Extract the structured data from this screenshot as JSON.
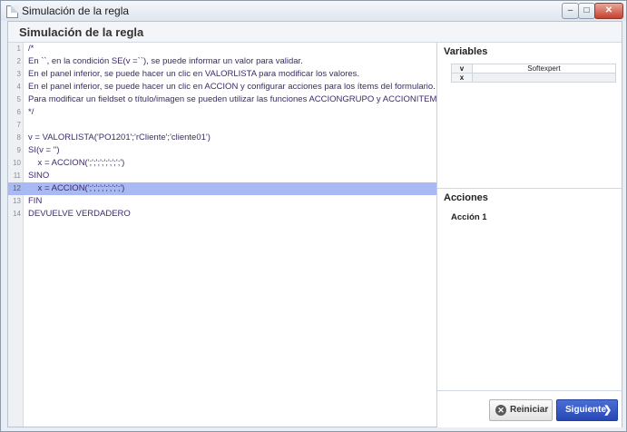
{
  "window": {
    "title": "Simulación de la regla",
    "controls": {
      "minimize": "–",
      "maximize": "□",
      "close": "✕"
    }
  },
  "dialog": {
    "title": "Simulación de la regla"
  },
  "editor": {
    "lines": [
      {
        "num": "1",
        "text": "/*"
      },
      {
        "num": "2",
        "text": "En ``, en la condición SE(v =``), se puede informar un valor para validar."
      },
      {
        "num": "3",
        "text": "En el panel inferior, se puede hacer un clic en VALORLISTA para modificar los valores."
      },
      {
        "num": "4",
        "text": "En el panel inferior, se puede hacer un clic en ACCION y configurar acciones para los ítems del formulario."
      },
      {
        "num": "5",
        "text": "Para modificar un fieldset o título/imagen se pueden utilizar las funciones ACCIONGRUPO y ACCIONITEMGRAFICO."
      },
      {
        "num": "6",
        "text": "*/"
      },
      {
        "num": "7",
        "text": ""
      },
      {
        "num": "8",
        "text": "v = VALORLISTA('PO1201';'rCliente';'cliente01')"
      },
      {
        "num": "9",
        "text": "SI(v = '')"
      },
      {
        "num": "10",
        "text": "    x = ACCION(';';';';';';';';')"
      },
      {
        "num": "11",
        "text": "SINO"
      },
      {
        "num": "12",
        "text": "    x = ACCION(';';';';';';';';')"
      },
      {
        "num": "13",
        "text": "FIN"
      },
      {
        "num": "14",
        "text": "DEVUELVE VERDADERO"
      }
    ],
    "highlighted_line": "12"
  },
  "variables": {
    "title": "Variables",
    "rows": [
      {
        "name": "v",
        "value": "Softexpert"
      },
      {
        "name": "x",
        "value": ""
      }
    ]
  },
  "actions": {
    "title": "Acciones",
    "items": [
      "Acción 1"
    ]
  },
  "footer": {
    "reset_label": "Reiniciar",
    "next_label": "Siguiente",
    "reset_icon": "reset-icon",
    "next_icon": "chevron-right-icon",
    "accent_color": "#2f54c4"
  }
}
